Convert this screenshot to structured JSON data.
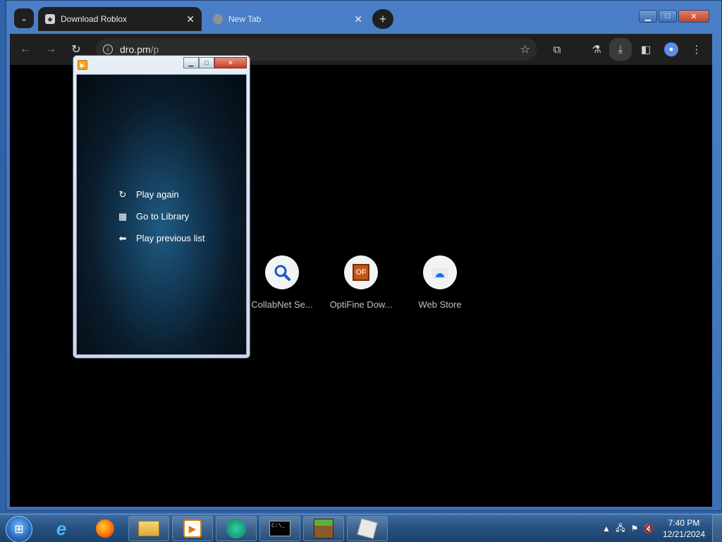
{
  "browser": {
    "tabs": [
      {
        "label": "Download Roblox",
        "favicon": "roblox-icon",
        "active": true
      },
      {
        "label": "New Tab",
        "favicon": "globe-icon",
        "active": false
      }
    ],
    "address": {
      "host": "dro.pm",
      "path": "/p"
    },
    "shortcuts": [
      {
        "label": "CollabNet Se...",
        "icon": "magnifier-icon",
        "color": "#1a73e8"
      },
      {
        "label": "OptiFine Dow...",
        "icon": "optifine-icon",
        "color": "#c0571c",
        "text": "OF"
      },
      {
        "label": "Web Store",
        "icon": "webstore-icon",
        "color": "#1a73e8"
      }
    ]
  },
  "player": {
    "menu": [
      {
        "label": "Play again",
        "icon": "replay-icon"
      },
      {
        "label": "Go to Library",
        "icon": "library-icon"
      },
      {
        "label": "Play previous list",
        "icon": "back-arrow-icon"
      }
    ]
  },
  "taskbar": {
    "apps": [
      "internet-explorer-icon",
      "firefox-icon",
      "file-explorer-icon",
      "media-player-icon",
      "photos-icon",
      "command-prompt-icon",
      "minecraft-icon",
      "roblox-icon"
    ],
    "clock": {
      "time": "7:40 PM",
      "date": "12/21/2024"
    }
  }
}
